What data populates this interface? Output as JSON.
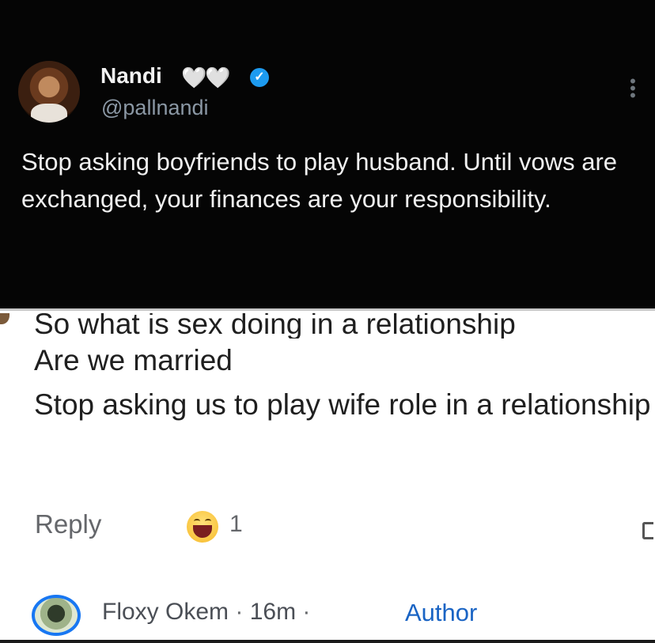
{
  "tweet": {
    "name": "Nandi",
    "name_emoji": "🤍🤍",
    "handle": "@pallnandi",
    "more_icon": "⋮",
    "text": "Stop asking boyfriends to play husband. Until vows are exchanged, your finances are your responsibility."
  },
  "comment": {
    "cut_line": "So what is sex doing in a relationship",
    "line2": "Are we married",
    "line3": "Stop asking us to play wife role in a relationship",
    "reply_label": "Reply",
    "reaction_icon": "haha-emoji",
    "reaction_count": "1",
    "author_name": "Floxy Okem",
    "time": "16m",
    "author_tag": "Author"
  },
  "colors": {
    "tweet_bg": "#050505",
    "verified": "#1d9bf0",
    "author_ring": "#1877f2",
    "author_tag": "#1a64c4"
  }
}
